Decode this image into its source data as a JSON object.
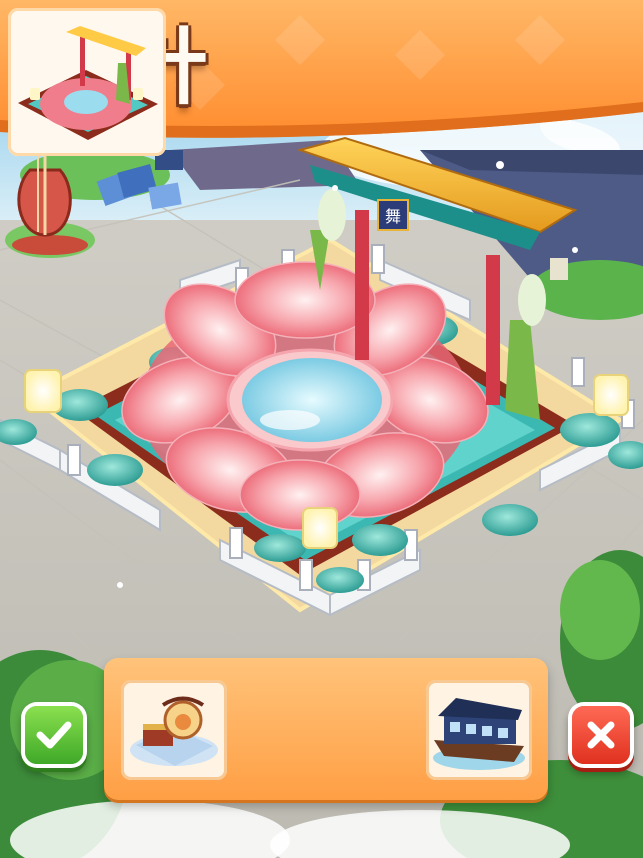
{
  "header": {
    "title": "設計"
  },
  "selector": {
    "items": [
      {
        "icon": "treasure-chest-decor-icon",
        "state": "unselected"
      },
      {
        "icon": "lotus-fountain-pavilion-icon",
        "state": "selected"
      },
      {
        "icon": "boat-house-icon",
        "state": "unselected"
      }
    ]
  },
  "actions": {
    "confirm_icon": "check-icon",
    "cancel_icon": "close-icon"
  },
  "scene": {
    "gate_sign": "舞"
  },
  "colors": {
    "banner": "#ff9b45",
    "confirm": "#4cb52f",
    "cancel": "#e63a26",
    "lotus": "#f57b8a",
    "water": "#8fd6ea"
  }
}
